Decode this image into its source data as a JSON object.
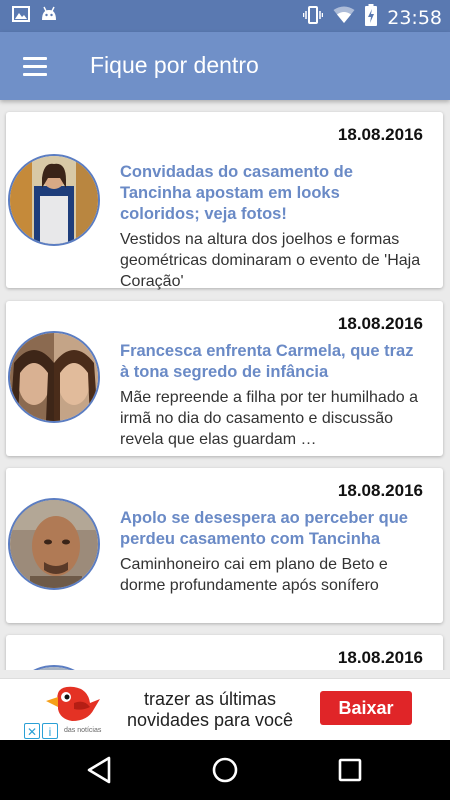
{
  "status_bar": {
    "time": "23:58",
    "left_icons": [
      "image-icon",
      "android-icon"
    ],
    "right_icons": [
      "vibrate-icon",
      "wifi-icon",
      "battery-charging-icon"
    ]
  },
  "toolbar": {
    "title": "Fique por dentro",
    "menu_icon": "hamburger-menu-icon"
  },
  "colors": {
    "toolbar": "#7090c8",
    "status_bar": "#5a79b1",
    "title_link": "#6a8ac6",
    "thumb_border": "#5b7dc2",
    "ad_button": "#e02528"
  },
  "articles": [
    {
      "date": "18.08.2016",
      "title": "Convidadas do casamento de Tancinha apostam em looks coloridos; veja fotos!",
      "description": "Vestidos na altura dos joelhos e formas geométricas dominaram o evento de 'Haja Coração'"
    },
    {
      "date": "18.08.2016",
      "title": "Francesca enfrenta Carmela, que traz à tona segredo de infância",
      "description": "Mãe repreende a filha por ter humilhado a irmã no dia do casamento e discussão revela que elas guardam …"
    },
    {
      "date": "18.08.2016",
      "title": "Apolo se desespera ao perceber que perdeu casamento com Tancinha",
      "description": "Caminhoneiro cai em plano de Beto e dorme profundamente após sonífero"
    },
    {
      "date": "18.08.2016",
      "title": "",
      "description": ""
    }
  ],
  "ad": {
    "text": "trazer as últimas novidades para você",
    "button": "Baixar",
    "source": "das notícias"
  },
  "nav_bar": {
    "icons": [
      "back-icon",
      "home-icon",
      "recents-icon"
    ]
  }
}
